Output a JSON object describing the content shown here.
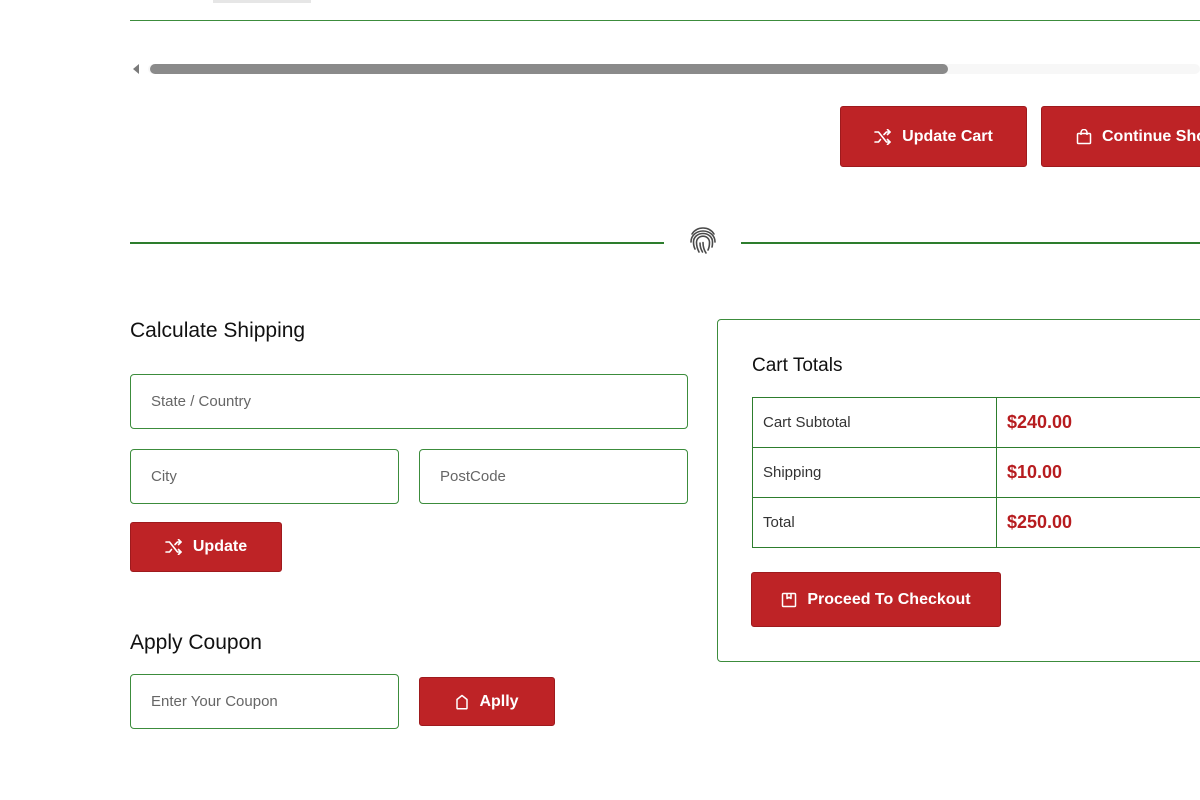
{
  "cart_actions": {
    "update_cart_label": "Update Cart",
    "continue_shopping_label": "Continue Shop"
  },
  "shipping": {
    "title": "Calculate Shipping",
    "state_placeholder": "State / Country",
    "city_placeholder": "City",
    "postcode_placeholder": "PostCode",
    "update_label": "Update"
  },
  "coupon": {
    "title": "Apply Coupon",
    "input_placeholder": "Enter Your Coupon",
    "apply_label": "Aplly"
  },
  "totals": {
    "title": "Cart Totals",
    "rows": [
      {
        "label": "Cart Subtotal",
        "value": "$240.00"
      },
      {
        "label": "Shipping",
        "value": "$10.00"
      },
      {
        "label": "Total",
        "value": "$250.00"
      }
    ],
    "checkout_label": "Proceed To Checkout"
  },
  "icons": {
    "update_cart": "shuffle-icon",
    "continue_shopping": "shopping-bag-icon",
    "divider": "fingerprint-icon",
    "update": "shuffle-icon",
    "apply": "tag-icon",
    "checkout": "package-icon"
  },
  "colors": {
    "accent_red": "#be2326",
    "border_green": "#3c8c3c",
    "price_red": "#b71c1f"
  }
}
